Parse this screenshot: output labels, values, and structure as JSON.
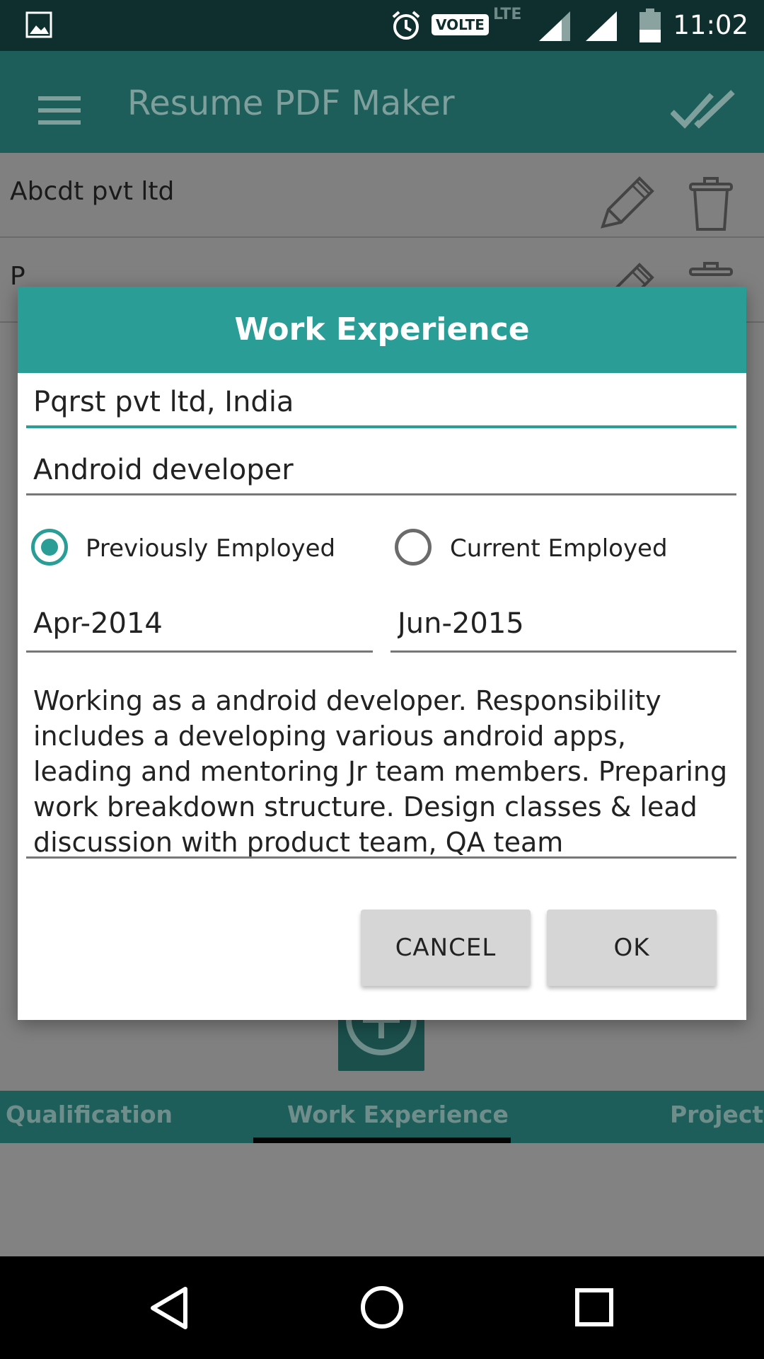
{
  "status_bar": {
    "time": "11:02",
    "volte": "VOLTE",
    "lte": "LTE",
    "icons": [
      "image-icon",
      "alarm-icon",
      "signal-icon",
      "signal-icon",
      "battery-icon"
    ]
  },
  "app_bar": {
    "title": "Resume PDF Maker",
    "icons": [
      "menu-icon",
      "double-check-icon"
    ]
  },
  "list": {
    "items": [
      {
        "label": "Abcdt pvt ltd"
      },
      {
        "label": "P"
      }
    ],
    "row_icons": [
      "pencil-icon",
      "trash-icon"
    ]
  },
  "dialog": {
    "title": "Work Experience",
    "company": {
      "value": "Pqrst pvt ltd, India"
    },
    "role": {
      "value": "Android developer"
    },
    "radios": {
      "previous_label": "Previously Employed",
      "current_label": "Current Employed",
      "selected": "previous"
    },
    "from": {
      "value": "Apr-2014"
    },
    "to": {
      "value": "Jun-2015"
    },
    "description": "Working as a android developer. Responsibility includes a developing various android apps, leading and mentoring Jr team members. Preparing work breakdown structure. Design classes & lead discussion with product team, QA team",
    "cancel_label": "CANCEL",
    "ok_label": "OK"
  },
  "tabs": [
    {
      "label": "Qualification"
    },
    {
      "label": "Work Experience",
      "active": true
    },
    {
      "label": "Projects"
    }
  ],
  "nav_bar": {
    "icons": [
      "back-icon",
      "home-icon",
      "recents-icon"
    ]
  },
  "colors": {
    "primary": "#2a9d97",
    "primary_dark": "#1d5e5a",
    "status_bar": "#0e2f2d"
  }
}
